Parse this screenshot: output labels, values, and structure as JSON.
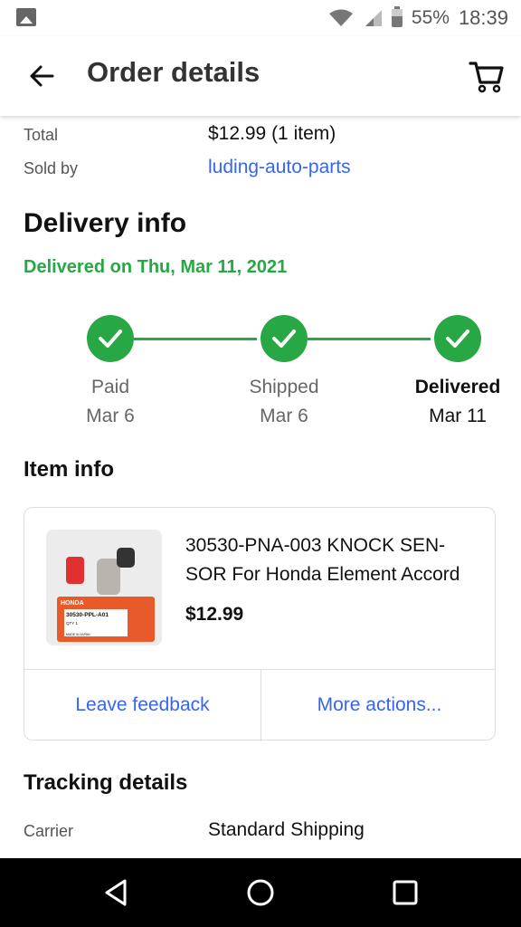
{
  "status": {
    "battery": "55%",
    "time": "18:39"
  },
  "header": {
    "title": "Order details"
  },
  "summary": {
    "total_label": "Total",
    "total_value": "$12.99 (1 item)",
    "seller_label": "Sold by",
    "seller_value": "luding-auto-parts"
  },
  "delivery": {
    "heading": "Delivery info",
    "status": "Delivered on Thu, Mar 11, 2021",
    "steps": [
      {
        "label": "Paid",
        "date": "Mar 6"
      },
      {
        "label": "Shipped",
        "date": "Mar 6"
      },
      {
        "label": "Delivered",
        "date": "Mar 11"
      }
    ]
  },
  "item": {
    "heading": "Item info",
    "title": "30530-PNA-003 KNOCK SEN-SOR For Honda Element Accord",
    "price": "$12.99",
    "image_text": {
      "brand": "HONDA",
      "part": "30530-PPL-A01",
      "qty": "QTY 1",
      "origin": "MADE IN JAPAN"
    },
    "feedback_button": "Leave feedback",
    "more_button": "More actions..."
  },
  "tracking": {
    "heading": "Tracking details",
    "carrier_label": "Carrier",
    "carrier_value": "Standard Shipping"
  },
  "colors": {
    "accent": "#3665f3",
    "success": "#28a745"
  }
}
